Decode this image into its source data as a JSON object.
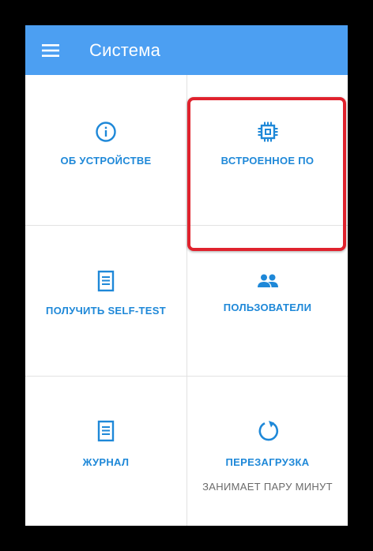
{
  "appbar": {
    "title": "Система",
    "menu_icon": "hamburger-menu-icon",
    "background": "#4c9ff2"
  },
  "tiles": [
    {
      "label": "ОБ УСТРОЙСТВЕ",
      "icon": "info-icon"
    },
    {
      "label": "ВСТРОЕННОЕ ПО",
      "icon": "chip-icon"
    },
    {
      "label": "ПОЛУЧИТЬ SELF-TEST",
      "icon": "document-icon"
    },
    {
      "label": "ПОЛЬЗОВАТЕЛИ",
      "icon": "users-icon"
    },
    {
      "label": "ЖУРНАЛ",
      "icon": "document-icon"
    },
    {
      "label": "ПЕРЕЗАГРУЗКА",
      "icon": "restart-icon",
      "sublabel": "ЗАНИМАЕТ ПАРУ МИНУТ"
    }
  ],
  "colors": {
    "accent": "#1e88d8",
    "highlight_border": "#e0222d",
    "sublabel": "#6b6b6b"
  }
}
